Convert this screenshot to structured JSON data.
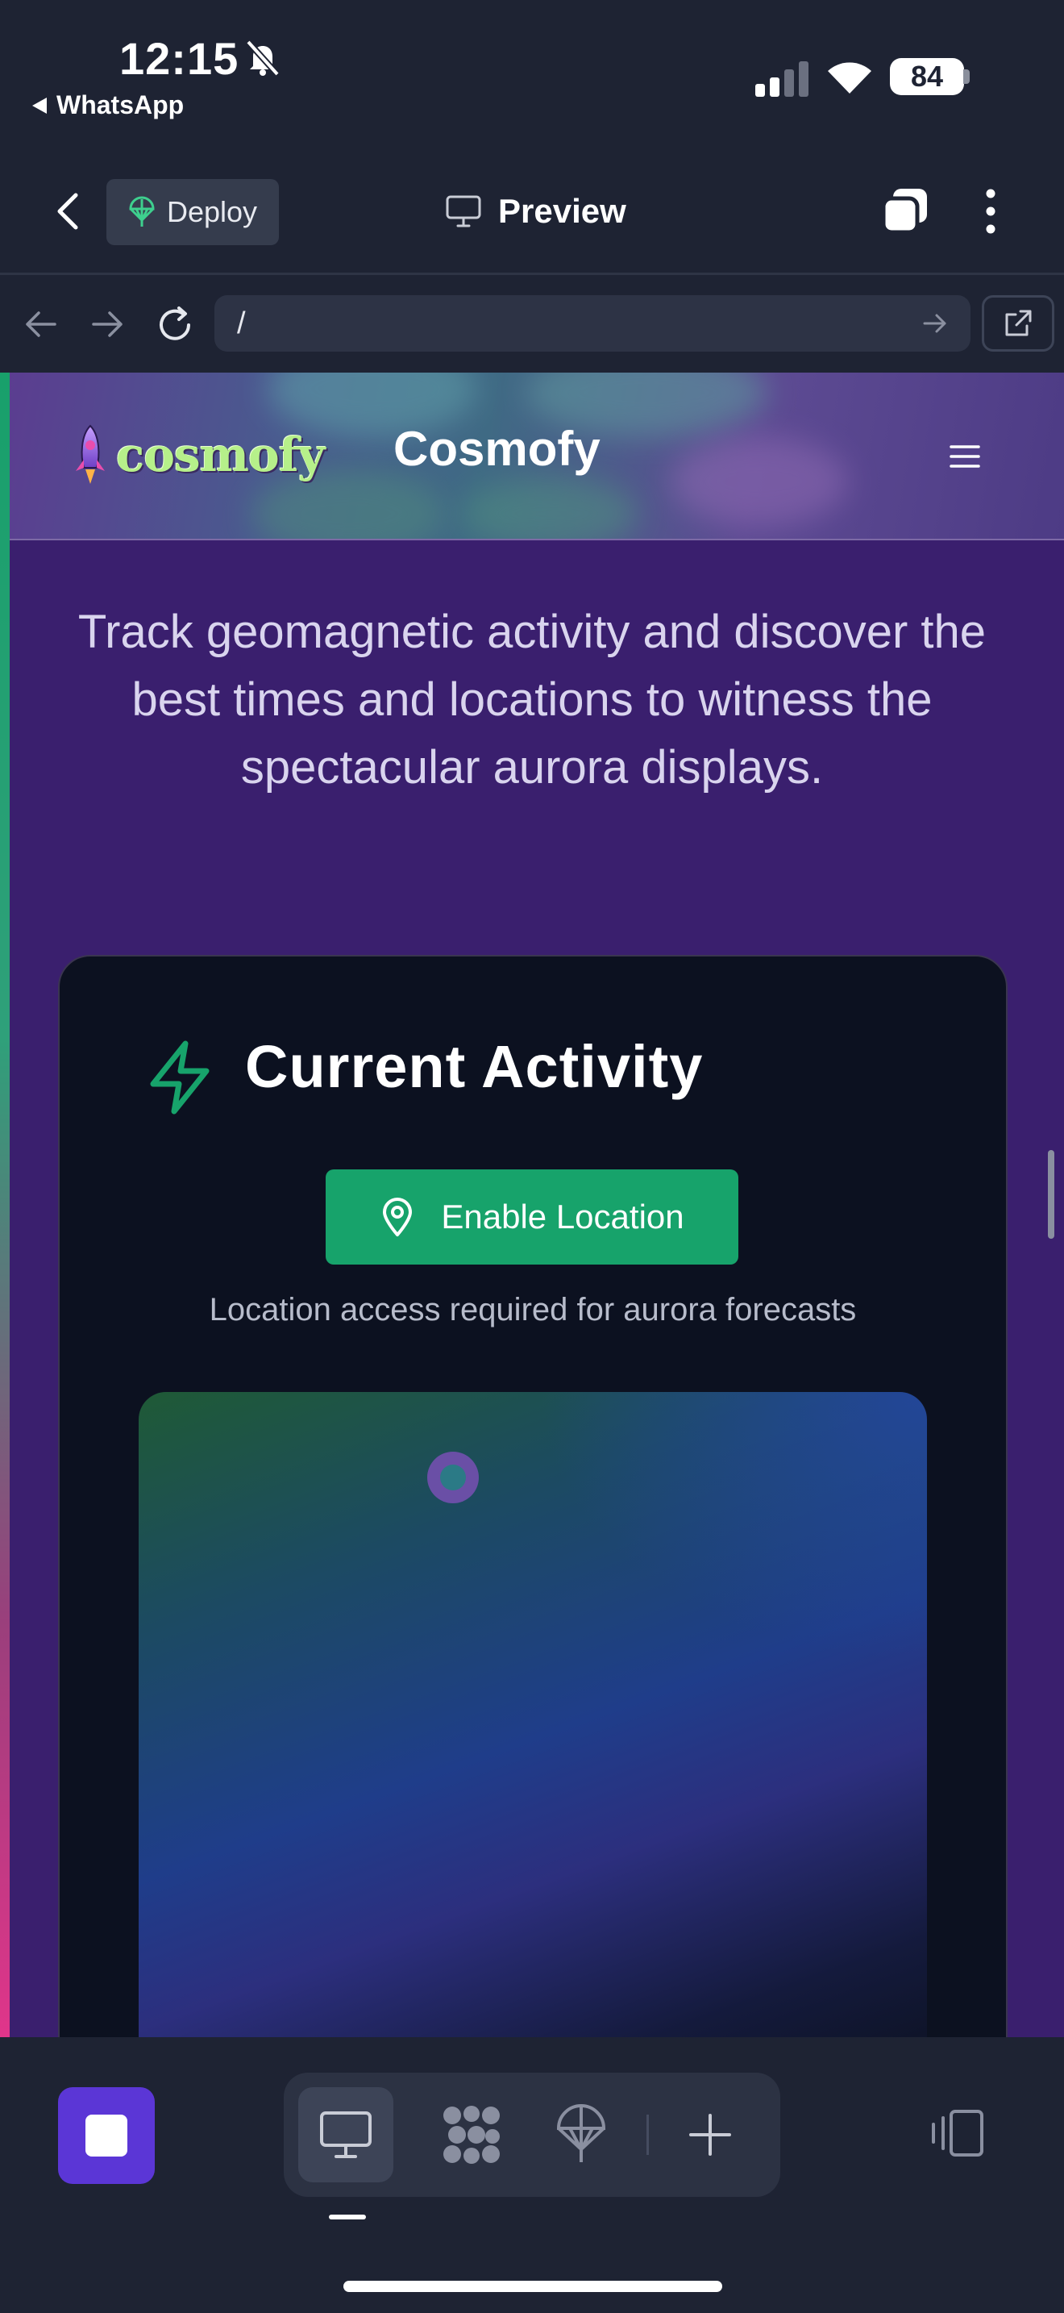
{
  "status_bar": {
    "time": "12:15",
    "back_app": "WhatsApp",
    "battery": "84"
  },
  "app_header": {
    "deploy_label": "Deploy",
    "preview_label": "Preview"
  },
  "url_bar": {
    "path": "/"
  },
  "site": {
    "logo_text": "cosmofy",
    "name": "Cosmofy",
    "tagline": "Track geomagnetic activity and discover the best times and locations to witness the spectacular aurora displays."
  },
  "card": {
    "title": "Current Activity",
    "enable_location_label": "Enable Location",
    "location_note": "Location access required for aurora forecasts"
  },
  "colors": {
    "accent_green": "#17a36b",
    "page_purple": "#3a1f6e",
    "stop_button": "#5b36d6",
    "card_bg": "#0c1120"
  },
  "toolbar": {
    "selected_tab": "desktop",
    "items": [
      "stop-icon",
      "desktop-icon",
      "grid-icon",
      "deploy-icon",
      "plus-icon",
      "panel-icon"
    ]
  }
}
